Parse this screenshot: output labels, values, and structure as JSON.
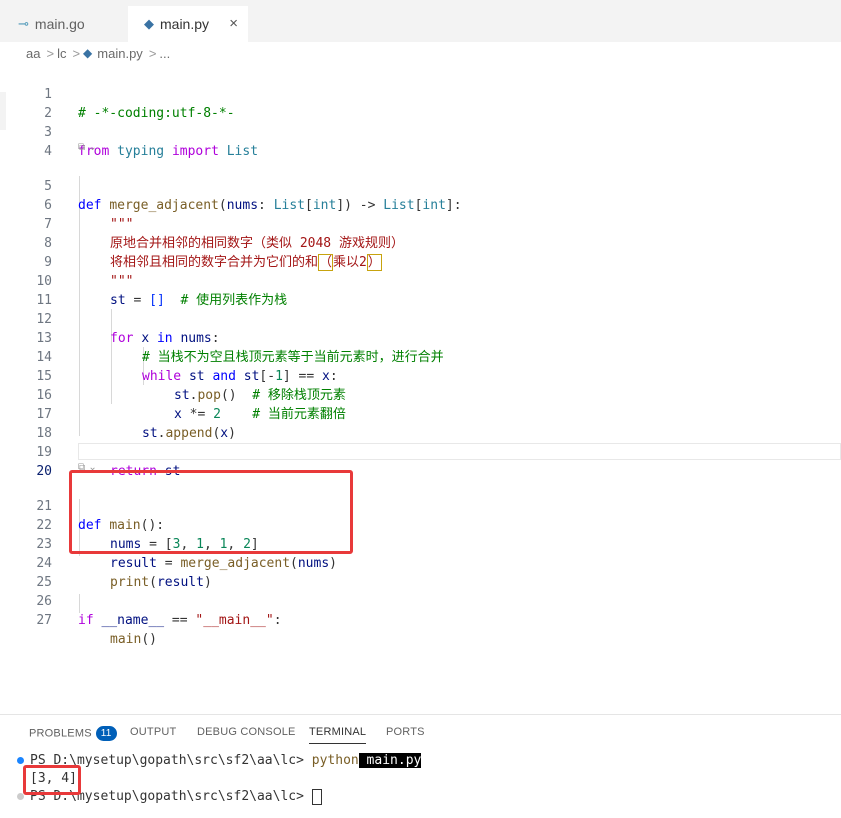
{
  "tabs": [
    {
      "label": "main.go",
      "icon": "go-icon",
      "active": false
    },
    {
      "label": "main.py",
      "icon": "python-icon",
      "active": true,
      "close": "×"
    }
  ],
  "breadcrumb": {
    "parts": [
      "aa",
      "lc",
      "main.py",
      "..."
    ],
    "sep": ">"
  },
  "codelens": "⧉ ⌄",
  "editor": {
    "line_numbers": [
      "1",
      "2",
      "3",
      "4",
      "5",
      "6",
      "7",
      "8",
      "9",
      "10",
      "11",
      "12",
      "13",
      "14",
      "15",
      "16",
      "17",
      "18",
      "19",
      "20",
      "21",
      "22",
      "23",
      "24",
      "25",
      "26",
      "27"
    ],
    "tokens": {
      "l1": "# -*-coding:utf-8-*-",
      "l3_from": "from",
      "l3_typing": "typing",
      "l3_import": "import",
      "l3_list": "List",
      "l5_def": "def",
      "l5_name": "merge_adjacent",
      "l5_p1": "(",
      "l5_nums": "nums",
      "l5_p2": ": ",
      "l5_list1": "List",
      "l5_p3": "[",
      "l5_int1": "int",
      "l5_p4": "]) -> ",
      "l5_list2": "List",
      "l5_p5": "[",
      "l5_int2": "int",
      "l5_p6": "]:",
      "l6": "\"\"\"",
      "l7": "原地合并相邻的相同数字（类似 2048 游戏规则）",
      "l8a": "将相邻且相同的数字合并为它们的和",
      "l8b": "（",
      "l8c": "乘以2",
      "l8d": "）",
      "l9": "\"\"\"",
      "l10_st": "st",
      "l10_eq": " = ",
      "l10_br": "[]",
      "l10_cm": "  # 使用列表作为栈",
      "l12_for": "for",
      "l12_x": "x",
      "l12_in": "in",
      "l12_nums": "nums",
      "l12_colon": ":",
      "l13": "# 当栈不为空且栈顶元素等于当前元素时，进行合并",
      "l14_while": "while",
      "l14_st1": "st",
      "l14_and": "and",
      "l14_st2": "st",
      "l14_idx1": "[-",
      "l14_one": "1",
      "l14_idx2": "] == ",
      "l14_x": "x",
      "l14_colon": ":",
      "l15_st": "st",
      "l15_pop": "pop",
      "l15_rest": "()",
      "l15_cm": "  # 移除栈顶元素",
      "l16_x": "x",
      "l16_op": " *= ",
      "l16_two": "2",
      "l16_cm": "    # 当前元素翻倍",
      "l17_st": "st",
      "l17_append": "append",
      "l17_p1": "(",
      "l17_x": "x",
      "l17_p2": ")",
      "l19_return": "return",
      "l19_st": "st",
      "l21_def": "def",
      "l21_name": "main",
      "l21_rest": "():",
      "l22_nums": "nums",
      "l22_rest1": " = [",
      "l22_3": "3",
      "l22_c1": ", ",
      "l22_1a": "1",
      "l22_c2": ", ",
      "l22_1b": "1",
      "l22_c3": ", ",
      "l22_2": "2",
      "l22_end": "]",
      "l23_result": "result",
      "l23_eq": " = ",
      "l23_fn": "merge_adjacent",
      "l23_p1": "(",
      "l23_nums": "nums",
      "l23_p2": ")",
      "l24_print": "print",
      "l24_p1": "(",
      "l24_result": "result",
      "l24_p2": ")",
      "l26_if": "if",
      "l26_name": "__name__",
      "l26_eq": " == ",
      "l26_str": "\"__main__\"",
      "l26_colon": ":",
      "l27_main": "main",
      "l27_rest": "()"
    }
  },
  "panel": {
    "tabs": [
      "PROBLEMS",
      "OUTPUT",
      "DEBUG CONSOLE",
      "TERMINAL",
      "PORTS"
    ],
    "problems_count": "11",
    "active_tab": "TERMINAL"
  },
  "terminal": {
    "prompt": "PS D:\\mysetup\\gopath\\src\\sf2\\aa\\lc> ",
    "cmd": "python",
    "arg": " main.py",
    "output": "[3, 4]",
    "prompt2": "PS D:\\mysetup\\gopath\\src\\sf2\\aa\\lc> "
  },
  "colors": {
    "accent": "#005fb8",
    "highlight_box": "#e8393a",
    "dot_blue": "#1a85ff",
    "dot_gray": "#cccccc"
  }
}
